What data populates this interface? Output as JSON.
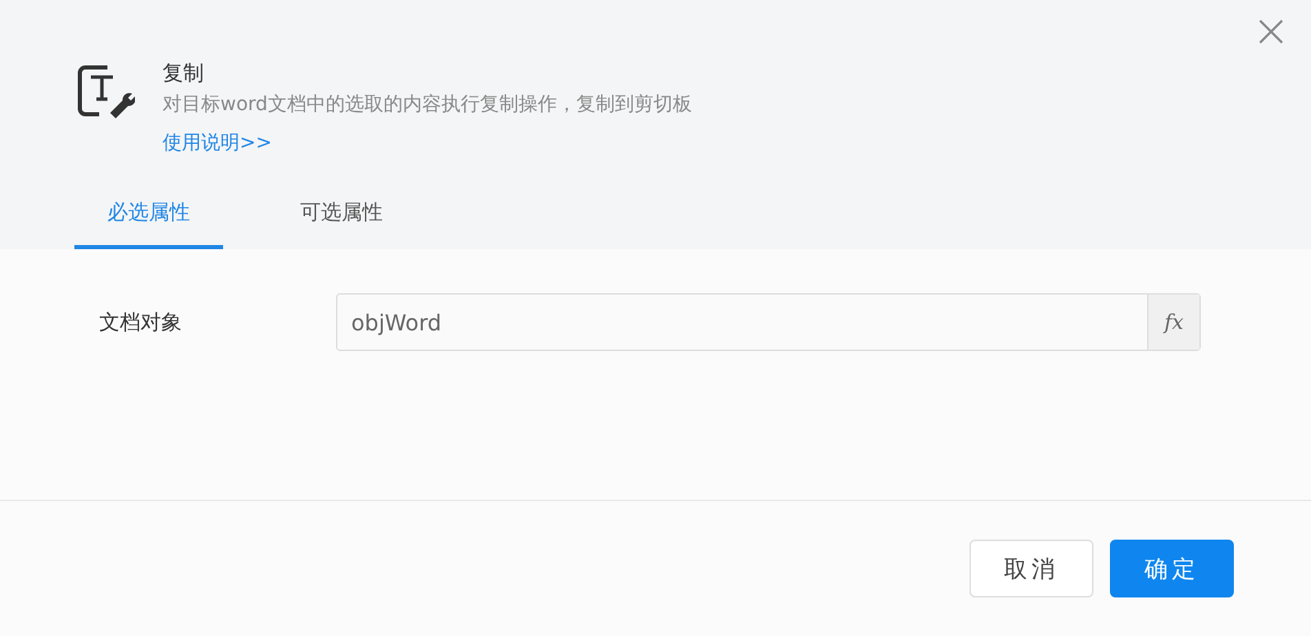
{
  "header": {
    "title": "复制",
    "description": "对目标word文档中的选取的内容执行复制操作，复制到剪切板",
    "help_link": "使用说明>>"
  },
  "tabs": [
    {
      "label": "必选属性",
      "selected": true
    },
    {
      "label": "可选属性",
      "selected": false
    }
  ],
  "fields": [
    {
      "label": "文档对象",
      "value": "objWord",
      "button": "fx"
    }
  ],
  "buttons": [
    {
      "label": "取消",
      "kind": "secondary"
    },
    {
      "label": "确定",
      "kind": "primary"
    }
  ]
}
